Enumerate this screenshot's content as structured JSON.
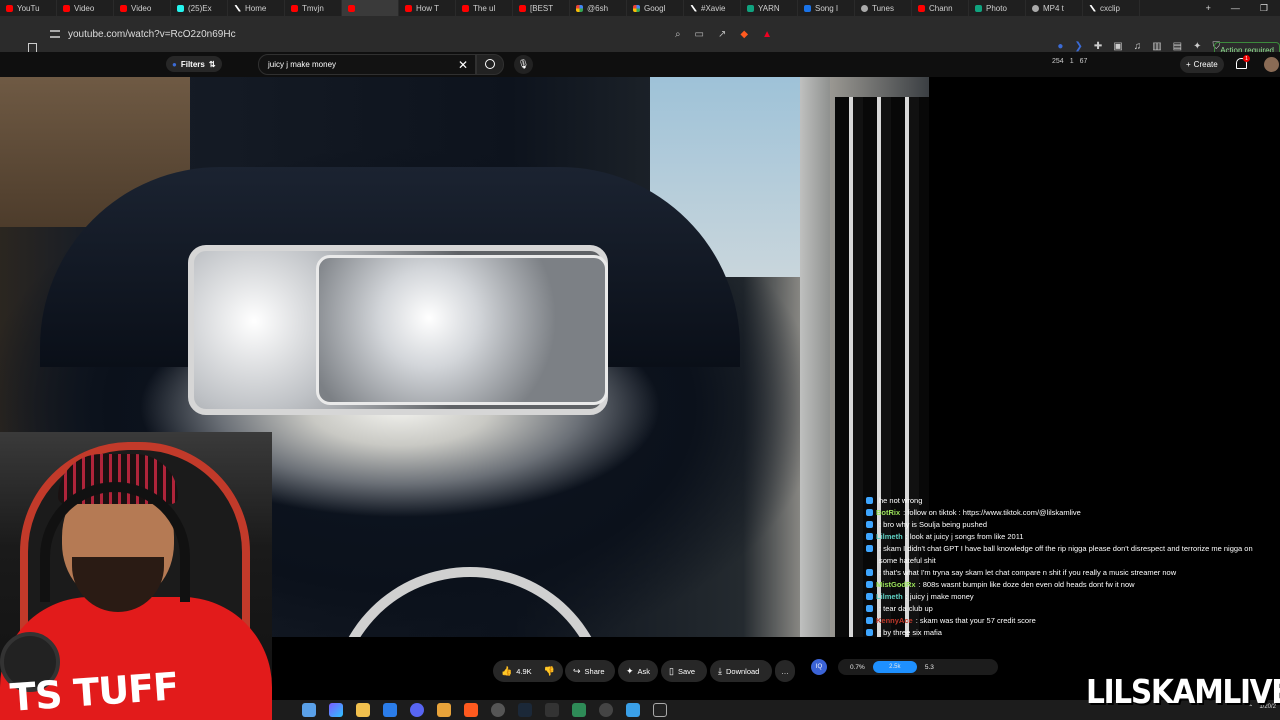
{
  "tabs": [
    {
      "label": "YouTu",
      "icon": "youtube-icon"
    },
    {
      "label": "Video",
      "icon": "youtube-icon"
    },
    {
      "label": "Video",
      "icon": "youtube-icon"
    },
    {
      "label": "(25)Ex",
      "icon": "tiktok-icon"
    },
    {
      "label": "Home",
      "icon": "x-icon"
    },
    {
      "label": "Tmvjn",
      "icon": "youtube-icon"
    },
    {
      "label": "",
      "icon": "youtube-icon",
      "active": true
    },
    {
      "label": "How T",
      "icon": "youtube-icon"
    },
    {
      "label": "The ul",
      "icon": "youtube-icon"
    },
    {
      "label": "[BEST",
      "icon": "youtube-icon"
    },
    {
      "label": "@6sh",
      "icon": "google-icon"
    },
    {
      "label": "Googl",
      "icon": "google-icon"
    },
    {
      "label": "#Xavie",
      "icon": "x-icon"
    },
    {
      "label": "YARN",
      "icon": "yarn-icon"
    },
    {
      "label": "Song I",
      "icon": "song-icon"
    },
    {
      "label": "Tunes",
      "icon": "gear-icon"
    },
    {
      "label": "Chann",
      "icon": "youtube-icon"
    },
    {
      "label": "Photo",
      "icon": "chatgpt-icon"
    },
    {
      "label": "MP4 t",
      "icon": "cloud-icon"
    },
    {
      "label": "cxclip",
      "icon": "x-icon"
    }
  ],
  "address": {
    "url": "youtube.com/watch?v=RcO2z0n69Hc"
  },
  "browser": {
    "action_required": "Action required"
  },
  "youtube": {
    "filters_label": "Filters",
    "search_value": "juicy j make money",
    "stats": [
      "254",
      "1",
      "67"
    ],
    "create_label": "Create",
    "bell_count": "1"
  },
  "actions": {
    "like_count": "4.9K",
    "share": "Share",
    "ask": "Ask",
    "save": "Save",
    "download": "Download",
    "more": "…"
  },
  "extension": {
    "percent": "0.7%",
    "bar_value": "2.5k",
    "side_value": "5.3"
  },
  "chat": [
    {
      "user": "",
      "msg": "he not wrong",
      "color": "#6fb3ff"
    },
    {
      "user": "BotRix",
      "msg": ": follow on tiktok : https://www.tiktok.com/@lilskamlive",
      "color": "#9be35a"
    },
    {
      "user": "",
      "msg": ": bro why is Soulja being pushed",
      "color": "#c0392b"
    },
    {
      "user": "Lilmeth",
      "msg": ": look at juicy j songs from like 2011",
      "color": "#5fd1c3"
    },
    {
      "user": "",
      "msg": ": skam I didn't chat GPT I have ball knowledge off the rip nigga please don't disrespect and terrorize me nigga on some hateful shit",
      "color": "#3b6bd6"
    },
    {
      "user": "",
      "msg": ": that's what I'm tryna say skam let chat compare n shit if you really a music streamer now",
      "color": "#c0392b"
    },
    {
      "user": "MistGodRx",
      "msg": ": 808s wasnt bumpin like doze den even old heads dont fw it now",
      "color": "#9be35a"
    },
    {
      "user": "Lilmeth",
      "msg": ": juicy j make money",
      "color": "#5fd1c3"
    },
    {
      "user": "",
      "msg": ": tear da club up",
      "color": "#3b6bd6"
    },
    {
      "user": "KennyAce",
      "msg": ": skam was that your 57 credit score",
      "color": "#c0392b"
    },
    {
      "user": "",
      "msg": ": by three six mafia",
      "color": "#3b6bd6"
    }
  ],
  "webcam": {
    "shirt_text": "TS TUFF"
  },
  "watermark": "LILSKAMLIVE",
  "tray": {
    "date": "1/20/2"
  }
}
